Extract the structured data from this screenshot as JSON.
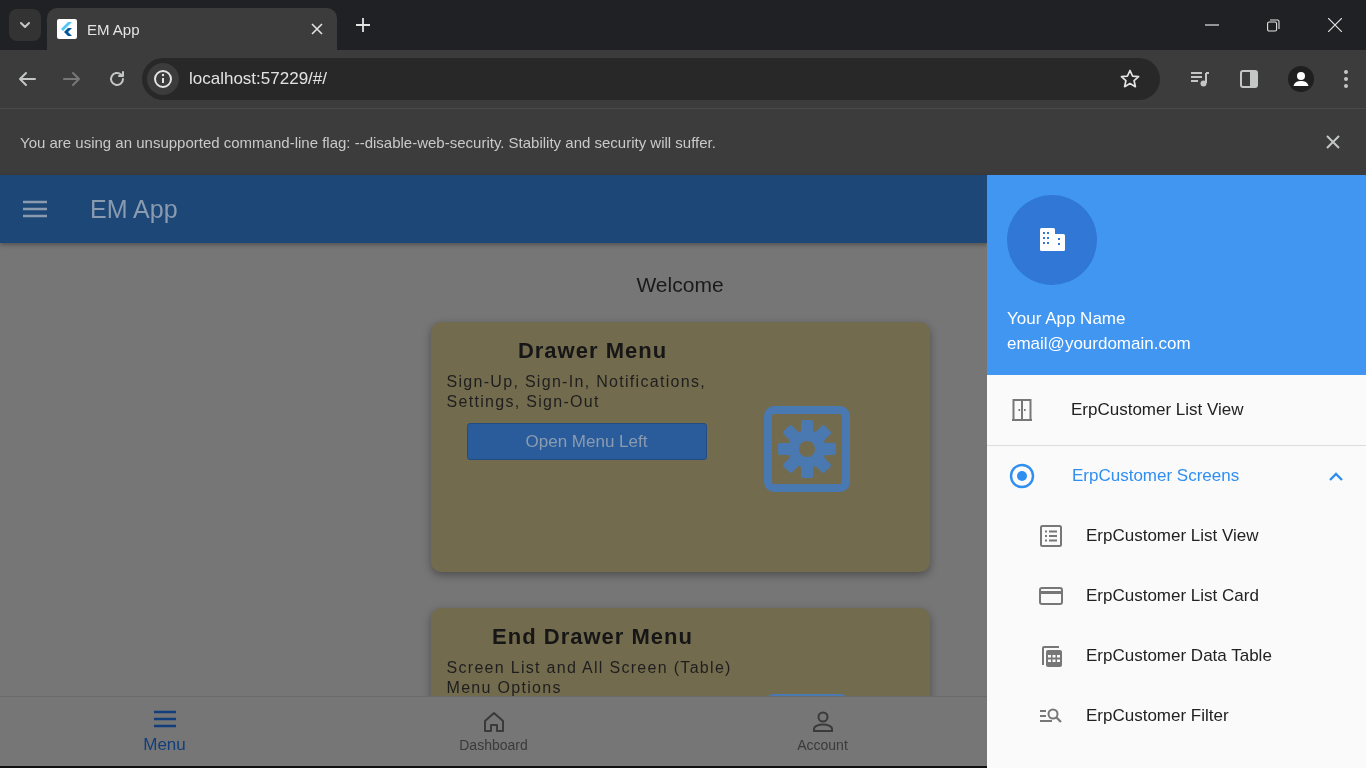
{
  "browser": {
    "tabs": [
      {
        "title": "EM App",
        "selected": true
      }
    ],
    "address": "localhost:57229/#/",
    "infobar": "You are using an unsupported command-line flag: --disable-web-security. Stability and security will suffer."
  },
  "app_bar": {
    "title": "EM App"
  },
  "welcome": "Welcome",
  "cards": [
    {
      "title": "Drawer Menu",
      "description": "Sign-Up, Sign-In, Notifications, Settings, Sign-Out",
      "button": "Open Menu Left"
    },
    {
      "title": "End Drawer Menu",
      "description": "Screen List and All Screen (Table) Menu Options"
    }
  ],
  "bottom_nav": [
    {
      "label": "Menu",
      "selected": true
    },
    {
      "label": "Dashboard",
      "selected": false
    },
    {
      "label": "Account",
      "selected": false
    }
  ],
  "drawer": {
    "header": {
      "name": "Your App Name",
      "email": "email@yourdomain.com"
    },
    "items": [
      {
        "kind": "item",
        "label": "ErpCustomer List View"
      },
      {
        "kind": "group",
        "label": "ErpCustomer Screens",
        "selected": true,
        "expanded": true,
        "children": [
          {
            "label": "ErpCustomer List View"
          },
          {
            "label": "ErpCustomer List Card"
          },
          {
            "label": "ErpCustomer Data Table"
          },
          {
            "label": "ErpCustomer Filter"
          }
        ]
      }
    ]
  }
}
